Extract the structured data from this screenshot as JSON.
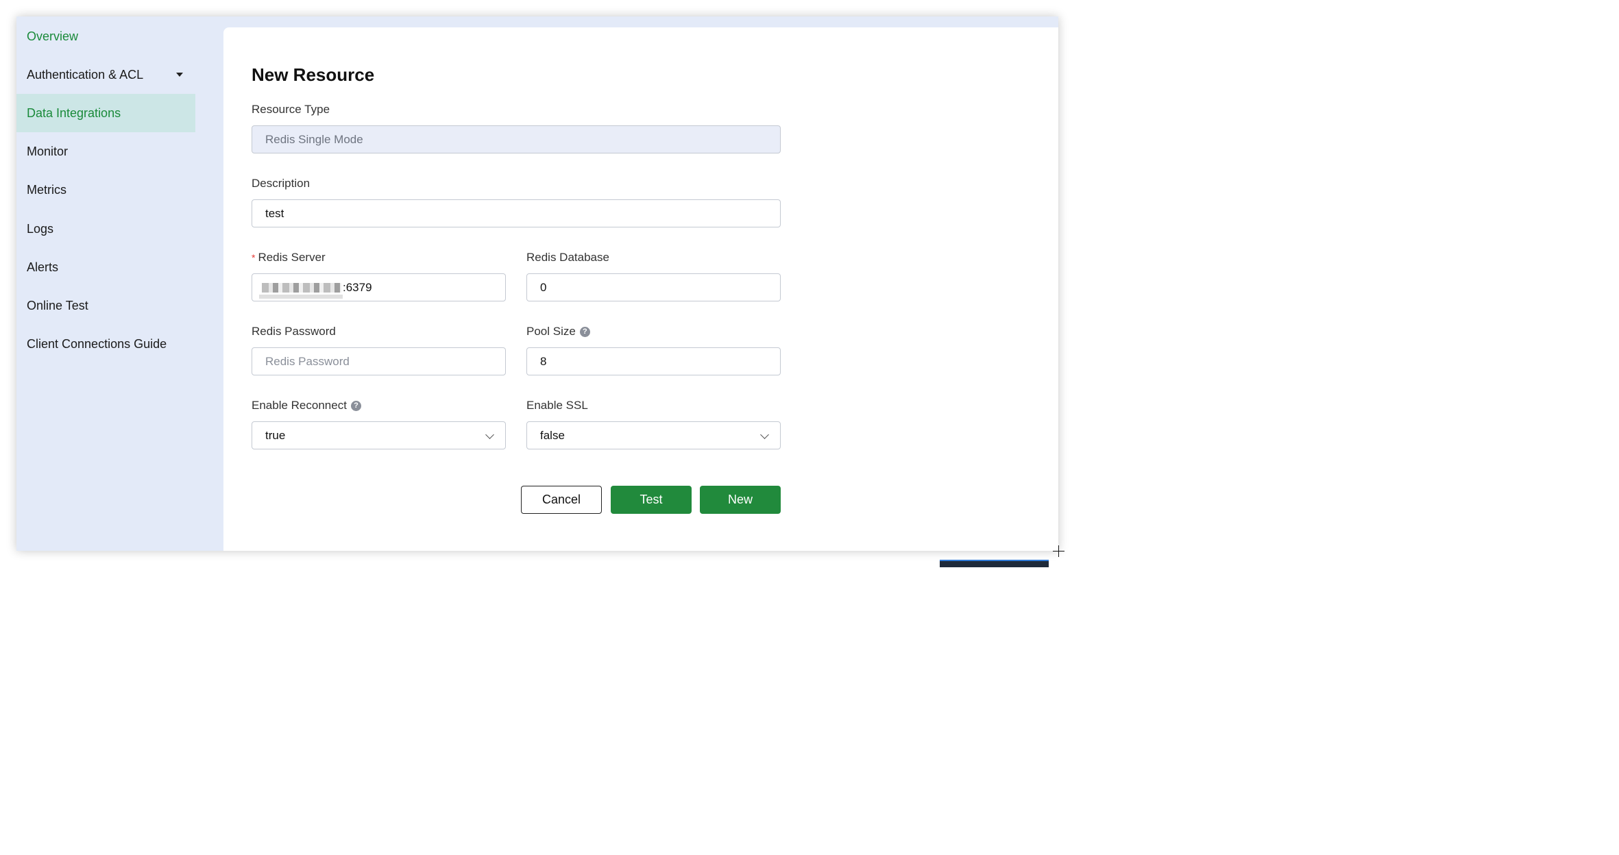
{
  "sidebar": {
    "items": [
      {
        "label": "Overview"
      },
      {
        "label": "Authentication & ACL"
      },
      {
        "label": "Data Integrations"
      },
      {
        "label": "Monitor"
      },
      {
        "label": "Metrics"
      },
      {
        "label": "Logs"
      },
      {
        "label": "Alerts"
      },
      {
        "label": "Online Test"
      },
      {
        "label": "Client Connections Guide"
      }
    ],
    "active_item": "Data Integrations"
  },
  "form": {
    "title": "New Resource",
    "resource_type": {
      "label": "Resource Type",
      "value": "Redis Single Mode"
    },
    "description": {
      "label": "Description",
      "value": "test"
    },
    "redis_server": {
      "label": "Redis Server",
      "required_mark": "*",
      "value_suffix": ":6379"
    },
    "redis_database": {
      "label": "Redis Database",
      "value": "0"
    },
    "redis_password": {
      "label": "Redis Password",
      "placeholder": "Redis Password",
      "value": ""
    },
    "pool_size": {
      "label": "Pool Size",
      "value": "8"
    },
    "enable_reconnect": {
      "label": "Enable Reconnect",
      "value": "true"
    },
    "enable_ssl": {
      "label": "Enable SSL",
      "value": "false"
    },
    "help_glyph": "?"
  },
  "buttons": {
    "cancel": "Cancel",
    "test": "Test",
    "new": "New"
  },
  "colors": {
    "accent_green": "#218a3c",
    "sidebar_bg": "#e3eaf8",
    "active_item_bg": "#cce6e6",
    "required_red": "#e53935"
  }
}
